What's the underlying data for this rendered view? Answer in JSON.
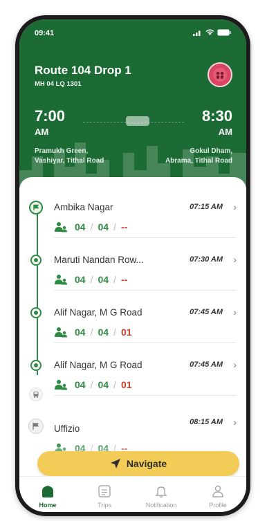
{
  "status_bar": {
    "time": "09:41"
  },
  "route": {
    "title": "Route 104 Drop 1",
    "vehicle_number": "MH 04 LQ 1301",
    "start_time": "7:00",
    "start_ampm": "AM",
    "end_time": "8:30",
    "end_ampm": "AM",
    "from_line1": "Pramukh Green,",
    "from_line2": "Vashiyar, Tithal Road",
    "to_line1": "Gokul Dham,",
    "to_line2": "Abrama, Tithal Road"
  },
  "stops": [
    {
      "name": "Ambika Nagar",
      "time": "07:15 AM",
      "count1": "04",
      "count2": "04",
      "count3": "--"
    },
    {
      "name": "Maruti Nandan Row...",
      "time": "07:30 AM",
      "count1": "04",
      "count2": "04",
      "count3": "--"
    },
    {
      "name": "Alif Nagar, M G Road",
      "time": "07:45 AM",
      "count1": "04",
      "count2": "04",
      "count3": "01"
    },
    {
      "name": "Alif Nagar, M G Road",
      "time": "07:45 AM",
      "count1": "04",
      "count2": "04",
      "count3": "01"
    },
    {
      "name": "Uffizio",
      "time": "08:15 AM",
      "count1": "04",
      "count2": "04",
      "count3": "--"
    }
  ],
  "separator": "/",
  "navigate_label": "Navigate",
  "tabs": [
    {
      "label": "Home"
    },
    {
      "label": "Trips"
    },
    {
      "label": "Notification"
    },
    {
      "label": "Profile"
    }
  ],
  "colors": {
    "brand_green": "#1d6b34",
    "accent_yellow": "#f3cc58",
    "count_green": "#2e8b42",
    "count_red": "#c83a25"
  }
}
